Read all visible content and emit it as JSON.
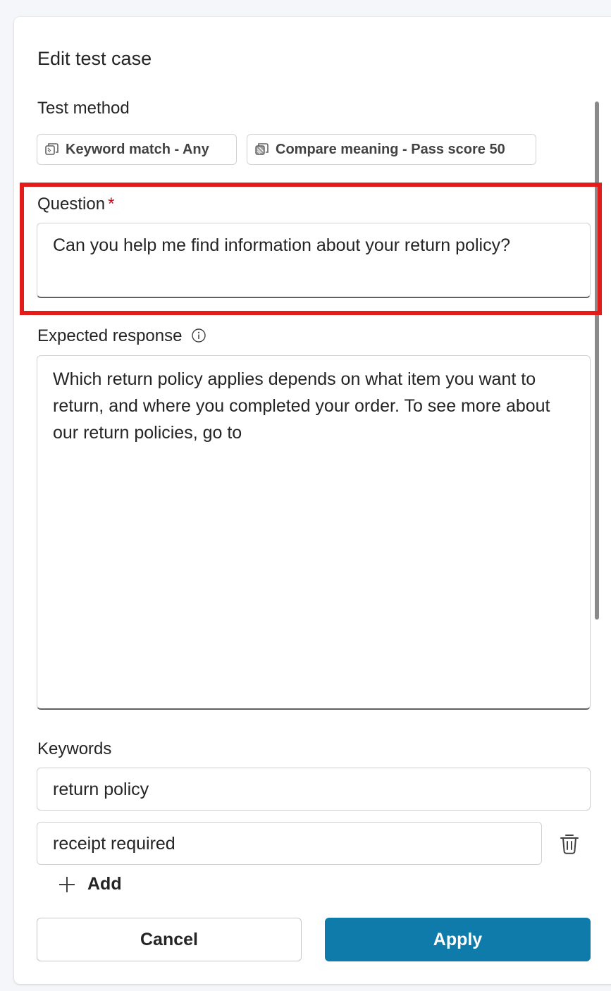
{
  "dialog": {
    "title": "Edit test case"
  },
  "test_method": {
    "label": "Test method",
    "chips": [
      {
        "label": "Keyword match - Any",
        "icon": "keyword-match-icon"
      },
      {
        "label": "Compare meaning - Pass score 50",
        "icon": "compare-meaning-icon"
      }
    ]
  },
  "question": {
    "label": "Question",
    "required_marker": "*",
    "value": "Can you help me find information about your return policy?"
  },
  "expected_response": {
    "label": "Expected response",
    "info_icon": "info-icon",
    "value": "Which return policy applies depends on what item you want to return, and where you completed your order. To see more about our return policies, go to"
  },
  "keywords": {
    "label": "Keywords",
    "items": [
      {
        "value": "return policy"
      },
      {
        "value": "receipt required"
      }
    ],
    "delete_icon": "trash-icon",
    "add_label": "Add",
    "add_icon": "plus-icon"
  },
  "footer": {
    "cancel_label": "Cancel",
    "apply_label": "Apply"
  },
  "colors": {
    "accent": "#0f7baa",
    "highlight": "#e21b1b",
    "required": "#c50f1f"
  }
}
